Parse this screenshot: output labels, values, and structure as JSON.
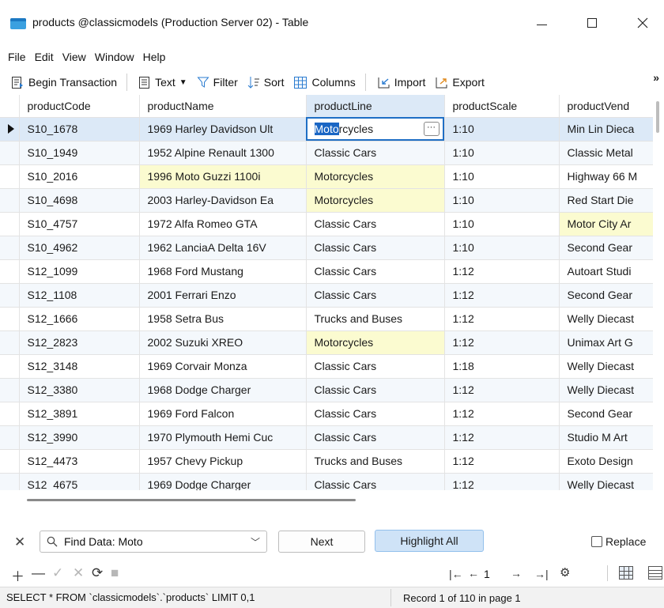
{
  "window": {
    "title": "products @classicmodels (Production Server 02) - Table",
    "minimize_icon": "minimize-icon",
    "maximize_icon": "maximize-icon",
    "close_icon": "close-icon"
  },
  "menu": [
    "File",
    "Edit",
    "View",
    "Window",
    "Help"
  ],
  "toolbar": {
    "begin_transaction": "Begin Transaction",
    "text": "Text",
    "filter": "Filter",
    "sort": "Sort",
    "columns": "Columns",
    "import": "Import",
    "export": "Export",
    "more": "»"
  },
  "grid": {
    "columns": [
      "productCode",
      "productName",
      "productLine",
      "productScale",
      "productVend"
    ],
    "rows": [
      [
        "S10_1678",
        "1969 Harley Davidson Ult",
        "Motorcycles",
        "1:10",
        "Min Lin Dieca"
      ],
      [
        "S10_1949",
        "1952 Alpine Renault 1300",
        "Classic Cars",
        "1:10",
        "Classic Metal"
      ],
      [
        "S10_2016",
        "1996 Moto Guzzi 1100i",
        "Motorcycles",
        "1:10",
        "Highway 66 M"
      ],
      [
        "S10_4698",
        "2003 Harley-Davidson Ea",
        "Motorcycles",
        "1:10",
        "Red Start Die"
      ],
      [
        "S10_4757",
        "1972 Alfa Romeo GTA",
        "Classic Cars",
        "1:10",
        "Motor City Ar"
      ],
      [
        "S10_4962",
        "1962 LanciaA Delta 16V",
        "Classic Cars",
        "1:10",
        "Second Gear"
      ],
      [
        "S12_1099",
        "1968 Ford Mustang",
        "Classic Cars",
        "1:12",
        "Autoart Studi"
      ],
      [
        "S12_1108",
        "2001 Ferrari Enzo",
        "Classic Cars",
        "1:12",
        "Second Gear"
      ],
      [
        "S12_1666",
        "1958 Setra Bus",
        "Trucks and Buses",
        "1:12",
        "Welly Diecast"
      ],
      [
        "S12_2823",
        "2002 Suzuki XREO",
        "Motorcycles",
        "1:12",
        "Unimax Art G"
      ],
      [
        "S12_3148",
        "1969 Corvair Monza",
        "Classic Cars",
        "1:18",
        "Welly Diecast"
      ],
      [
        "S12_3380",
        "1968 Dodge Charger",
        "Classic Cars",
        "1:12",
        "Welly Diecast"
      ],
      [
        "S12_3891",
        "1969 Ford Falcon",
        "Classic Cars",
        "1:12",
        "Second Gear"
      ],
      [
        "S12_3990",
        "1970 Plymouth Hemi Cuc",
        "Classic Cars",
        "1:12",
        "Studio M Art"
      ],
      [
        "S12_4473",
        "1957 Chevy Pickup",
        "Trucks and Buses",
        "1:12",
        "Exoto Design"
      ],
      [
        "S12_4675",
        "1969 Dodge Charger",
        "Classic Cars",
        "1:12",
        "Welly Diecast"
      ]
    ],
    "highlights": [
      [
        0,
        2
      ],
      [
        2,
        1
      ],
      [
        2,
        2
      ],
      [
        3,
        2
      ],
      [
        4,
        4
      ],
      [
        9,
        2
      ]
    ],
    "selected_text": "Moto",
    "selected_rest": "rcycles",
    "ellipsis": "···"
  },
  "find": {
    "value": "Find Data: Moto",
    "next": "Next",
    "highlight_all": "Highlight All",
    "replace": "Replace"
  },
  "bottom": {
    "page": "1"
  },
  "status": {
    "sql": "SELECT * FROM `classicmodels`.`products` LIMIT 0,1",
    "record": "Record 1 of 110 in page 1"
  },
  "colors": {
    "accent": "#1f6fc5",
    "highlight": "#fbfbd0",
    "selected_row": "#dce9f7"
  }
}
